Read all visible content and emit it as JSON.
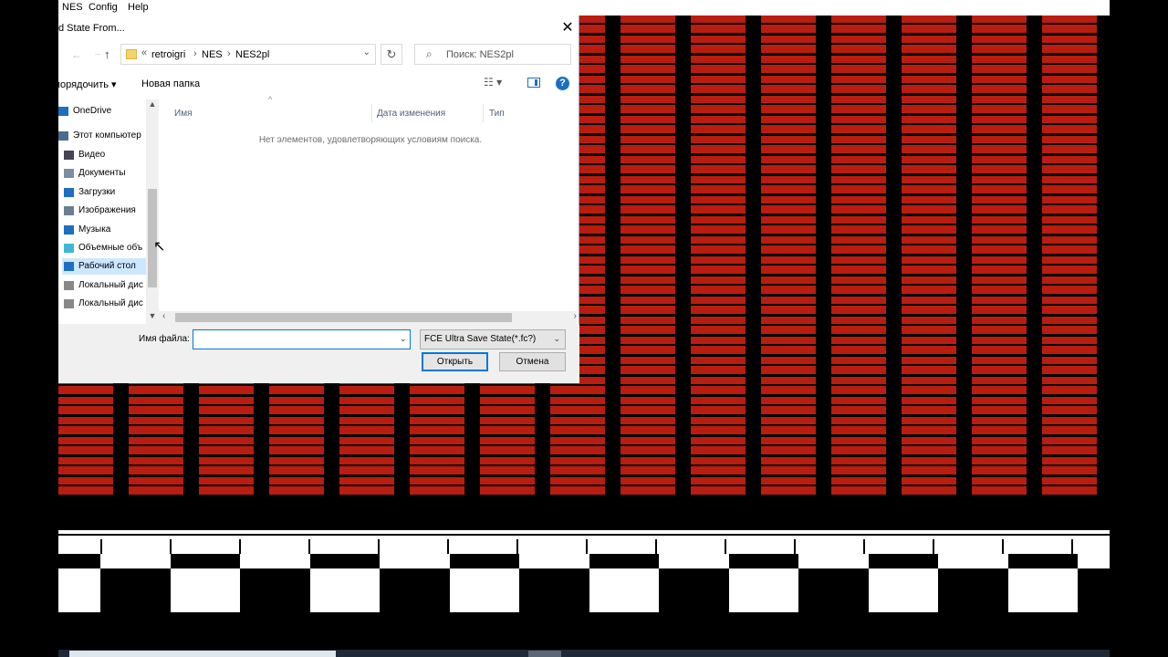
{
  "menubar": {
    "items": [
      "NES",
      "Config",
      "Help"
    ]
  },
  "dialog": {
    "title": "d State From...",
    "close_glyph": "✕",
    "address": {
      "chevron": "«",
      "crumbs": [
        "retroigri",
        "NES",
        "NES2pl"
      ]
    },
    "search_placeholder": "Поиск: NES2pl",
    "toolbar": {
      "organize_label": "порядочить ▾",
      "new_folder_label": "Новая папка"
    },
    "nav": {
      "items": [
        {
          "label": "OneDrive",
          "icon": "onedrive-icon"
        },
        {
          "label": "Этот компьютер",
          "icon": "computer-icon"
        },
        {
          "label": "Видео",
          "icon": "video-icon"
        },
        {
          "label": "Документы",
          "icon": "documents-icon"
        },
        {
          "label": "Загрузки",
          "icon": "downloads-icon"
        },
        {
          "label": "Изображения",
          "icon": "images-icon"
        },
        {
          "label": "Музыка",
          "icon": "music-icon"
        },
        {
          "label": "Объемные объ",
          "icon": "3d-objects-icon"
        },
        {
          "label": "Рабочий стол",
          "icon": "desktop-icon"
        },
        {
          "label": "Локальный дис",
          "icon": "local-disk-icon"
        },
        {
          "label": "Локальный дис",
          "icon": "local-disk-icon"
        }
      ],
      "selected_index": 8
    },
    "columns": [
      "Имя",
      "Дата изменения",
      "Тип"
    ],
    "empty_message": "Нет элементов, удовлетворяющих условиям поиска.",
    "filename_label": "Имя файла:",
    "filename_value": "",
    "filetype_label": "FCE Ultra Save State(*.fc?)",
    "open_label": "Открыть",
    "cancel_label": "Отмена"
  },
  "colors": {
    "brick_red": "#b81d10",
    "accent_blue": "#0078d7",
    "selected_bg": "#cce8ff"
  }
}
